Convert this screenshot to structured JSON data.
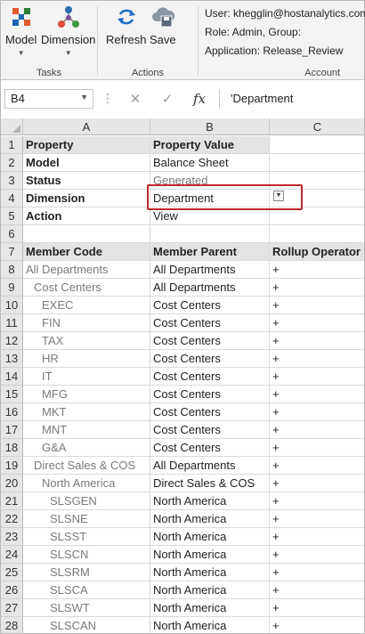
{
  "ribbon": {
    "groups": [
      {
        "label": "Tasks",
        "buttons": [
          {
            "label": "Model",
            "icon": "model-icon"
          },
          {
            "label": "Dimension",
            "icon": "dimension-icon"
          }
        ]
      },
      {
        "label": "Actions",
        "buttons": [
          {
            "label": "Refresh",
            "icon": "refresh-icon"
          },
          {
            "label": "Save",
            "icon": "cloud-save-icon"
          }
        ]
      },
      {
        "label": "Account"
      }
    ],
    "account": {
      "user": "User: khegglin@hostanalytics.com",
      "role": "Role: Admin, Group:",
      "application": "Application: Release_Review"
    },
    "colors": {
      "model_icon": [
        "#e2592c",
        "#2e7d32",
        "#1e64b4"
      ],
      "dimension_icon": [
        "#2b6cb0",
        "#d94f3a",
        "#3c9a45"
      ],
      "refresh": "#1e6fc3",
      "save": "#6f7d8a"
    }
  },
  "formula_bar": {
    "name_box": "B4",
    "cancel": "✕",
    "enter": "✓",
    "fx": "fx",
    "value": "'Department"
  },
  "grid": {
    "columns": [
      "A",
      "B",
      "C"
    ],
    "rows": [
      {
        "n": "1",
        "a": "Property",
        "b": "Property Value",
        "c": "",
        "style": "prop-hdr"
      },
      {
        "n": "2",
        "a": "Model",
        "b": "Balance Sheet",
        "c": "",
        "style": "prop"
      },
      {
        "n": "3",
        "a": "Status",
        "b": "Generated",
        "c": "",
        "style": "prop-muted"
      },
      {
        "n": "4",
        "a": "Dimension",
        "b": "Department",
        "c": "",
        "style": "prop"
      },
      {
        "n": "5",
        "a": "Action",
        "b": "View",
        "c": "",
        "style": "prop"
      },
      {
        "n": "6",
        "a": "",
        "b": "",
        "c": "",
        "style": "blank"
      },
      {
        "n": "7",
        "a": "Member Code",
        "b": "Member Parent",
        "c": "Rollup Operator",
        "style": "mem-hdr"
      },
      {
        "n": "8",
        "a": "All Departments",
        "b": "All Departments",
        "c": "+",
        "indent": 0
      },
      {
        "n": "9",
        "a": "Cost Centers",
        "b": "All Departments",
        "c": "+",
        "indent": 1
      },
      {
        "n": "10",
        "a": "EXEC",
        "b": "Cost Centers",
        "c": "+",
        "indent": 2
      },
      {
        "n": "11",
        "a": "FIN",
        "b": "Cost Centers",
        "c": "+",
        "indent": 2
      },
      {
        "n": "12",
        "a": "TAX",
        "b": "Cost Centers",
        "c": "+",
        "indent": 2
      },
      {
        "n": "13",
        "a": "HR",
        "b": "Cost Centers",
        "c": "+",
        "indent": 2
      },
      {
        "n": "14",
        "a": "IT",
        "b": "Cost Centers",
        "c": "+",
        "indent": 2
      },
      {
        "n": "15",
        "a": "MFG",
        "b": "Cost Centers",
        "c": "+",
        "indent": 2
      },
      {
        "n": "16",
        "a": "MKT",
        "b": "Cost Centers",
        "c": "+",
        "indent": 2
      },
      {
        "n": "17",
        "a": "MNT",
        "b": "Cost Centers",
        "c": "+",
        "indent": 2
      },
      {
        "n": "18",
        "a": "G&A",
        "b": "Cost Centers",
        "c": "+",
        "indent": 2
      },
      {
        "n": "19",
        "a": "Direct Sales & COS",
        "b": "All Departments",
        "c": "+",
        "indent": 1
      },
      {
        "n": "20",
        "a": "North America",
        "b": "Direct Sales & COS",
        "c": "+",
        "indent": 2
      },
      {
        "n": "21",
        "a": "SLSGEN",
        "b": "North America",
        "c": "+",
        "indent": 3
      },
      {
        "n": "22",
        "a": "SLSNE",
        "b": "North America",
        "c": "+",
        "indent": 3
      },
      {
        "n": "23",
        "a": "SLSST",
        "b": "North America",
        "c": "+",
        "indent": 3
      },
      {
        "n": "24",
        "a": "SLSCN",
        "b": "North America",
        "c": "+",
        "indent": 3
      },
      {
        "n": "25",
        "a": "SLSRM",
        "b": "North America",
        "c": "+",
        "indent": 3
      },
      {
        "n": "26",
        "a": "SLSCA",
        "b": "North America",
        "c": "+",
        "indent": 3
      },
      {
        "n": "27",
        "a": "SLSWT",
        "b": "North America",
        "c": "+",
        "indent": 3
      },
      {
        "n": "28",
        "a": "SLSCAN",
        "b": "North America",
        "c": "+",
        "indent": 3
      }
    ],
    "selection": {
      "cell": "B4",
      "highlight_color": "#c0272d"
    }
  }
}
